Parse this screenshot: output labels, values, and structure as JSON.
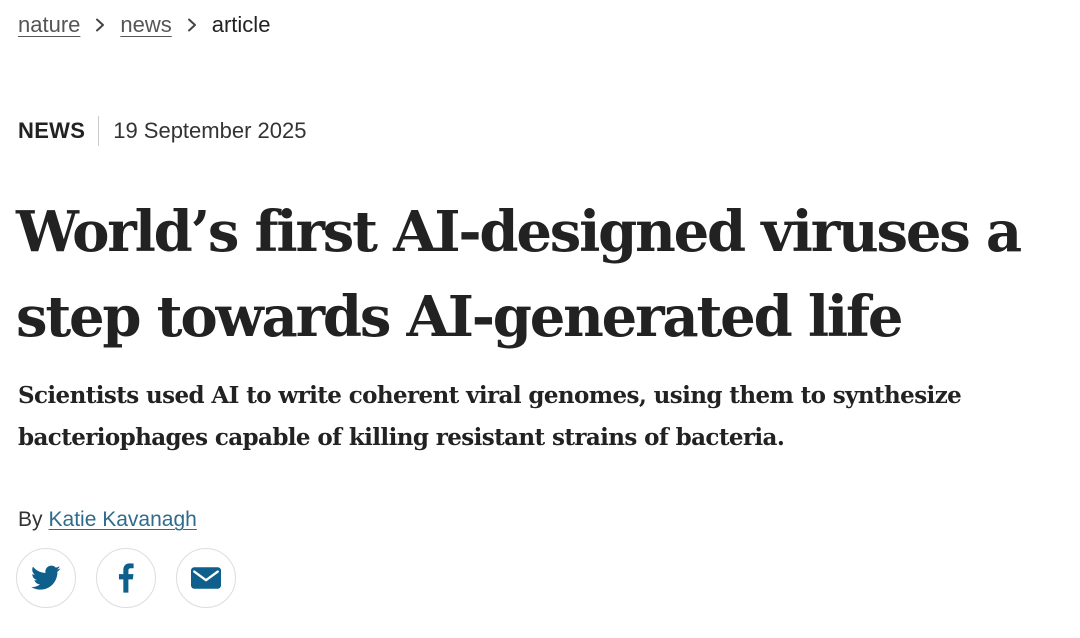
{
  "breadcrumb": {
    "items": [
      {
        "label": "nature",
        "link": true
      },
      {
        "label": "news",
        "link": true
      },
      {
        "label": "article",
        "link": false
      }
    ]
  },
  "article": {
    "type": "NEWS",
    "date": "19 September 2025",
    "title": "World’s first AI-designed viruses a step towards AI-generated life",
    "standfirst": "Scientists used AI to write coherent viral genomes, using them to synthesize bacteriophages capable of killing resistant strains of bacteria.",
    "byline_prefix": "By",
    "author": "Katie Kavanagh"
  },
  "share": {
    "buttons": [
      {
        "name": "twitter",
        "icon": "twitter-icon"
      },
      {
        "name": "facebook",
        "icon": "facebook-icon"
      },
      {
        "name": "email",
        "icon": "email-icon"
      }
    ],
    "icon_color": "#0f5f8c"
  },
  "colors": {
    "text": "#222222",
    "link": "#2e6b8c",
    "icon": "#0f5f8c"
  }
}
